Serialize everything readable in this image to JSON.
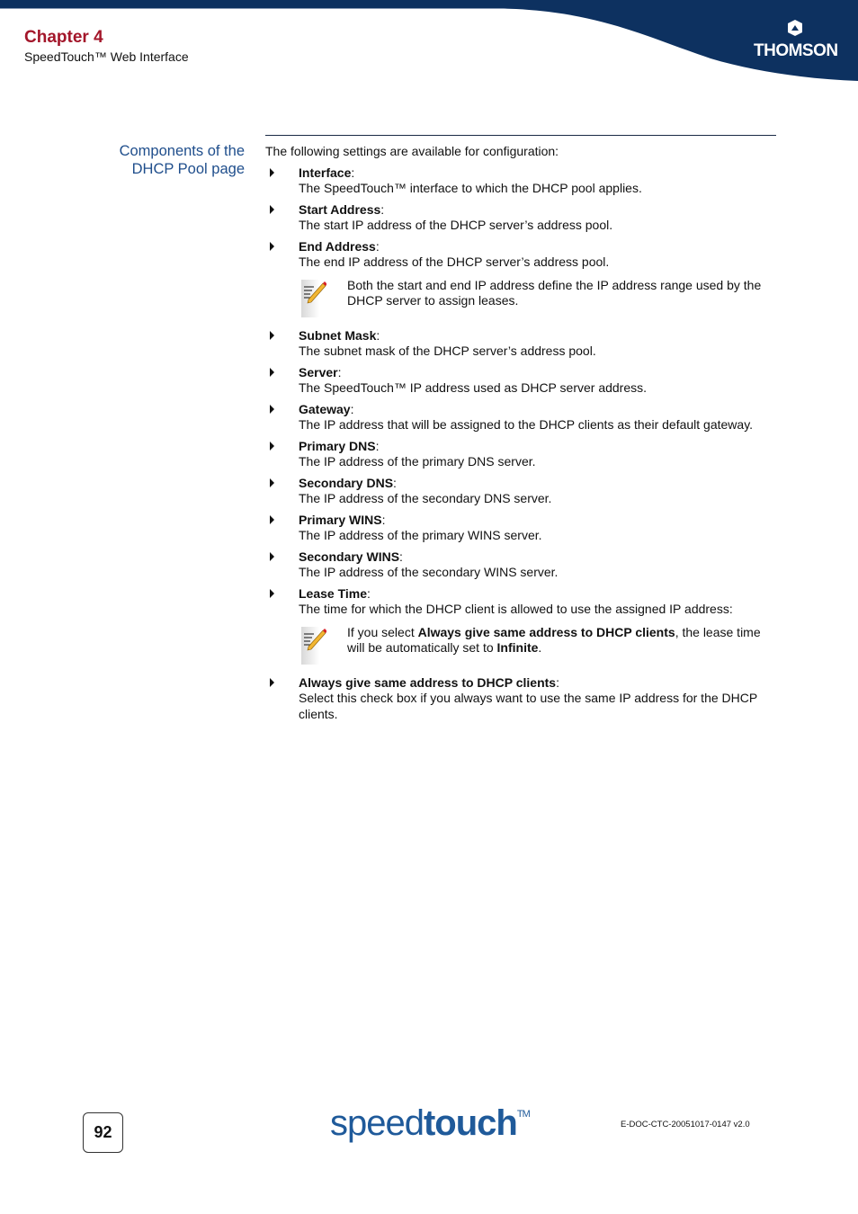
{
  "header": {
    "chapter": "Chapter 4",
    "subtitle": "SpeedTouch™ Web Interface",
    "brand_logo": "THOMSON",
    "colors": {
      "navy": "#0d3160",
      "chapter_red": "#a3162a",
      "section_blue": "#1f4e8c"
    }
  },
  "section": {
    "label": "Components of the DHCP Pool page",
    "intro": "The following settings are available for configuration:",
    "items": [
      {
        "title": "Interface",
        "desc": "The SpeedTouch™ interface to which the DHCP pool applies."
      },
      {
        "title": "Start Address",
        "desc": "The start IP address of the DHCP server’s address pool."
      },
      {
        "title": "End Address",
        "desc": "The end IP address of the DHCP server’s address pool."
      },
      {
        "title": "Subnet Mask",
        "desc": "The subnet mask of the DHCP server’s address pool."
      },
      {
        "title": "Server",
        "desc": "The SpeedTouch™ IP address used as DHCP server address."
      },
      {
        "title": "Gateway",
        "desc": "The IP address that will be assigned to the DHCP clients as their default gateway."
      },
      {
        "title": "Primary DNS",
        "desc": "The IP address of the primary DNS server."
      },
      {
        "title": "Secondary DNS",
        "desc": "The IP address of the secondary DNS server."
      },
      {
        "title": "Primary WINS",
        "desc": "The IP address of the primary WINS server."
      },
      {
        "title": "Secondary WINS",
        "desc": "The IP address of the secondary WINS server."
      },
      {
        "title": "Lease Time",
        "desc": "The time for which the DHCP client is allowed to use the assigned IP address:"
      },
      {
        "title": "Always give same address to DHCP clients",
        "desc": "Select this check box if you always want to use the same IP address for the DHCP clients."
      }
    ],
    "note1": "Both the start and end IP address define the IP address range used by the DHCP server to assign leases.",
    "note2": {
      "pre": "If you select ",
      "bold1": "Always give same address to DHCP clients",
      "mid": ", the lease time will be automatically set to ",
      "bold2": "Infinite",
      "post": "."
    }
  },
  "footer": {
    "page_number": "92",
    "brand_light": "speed",
    "brand_bold": "touch",
    "brand_tm": "TM",
    "doc_id": "E-DOC-CTC-20051017-0147 v2.0"
  }
}
